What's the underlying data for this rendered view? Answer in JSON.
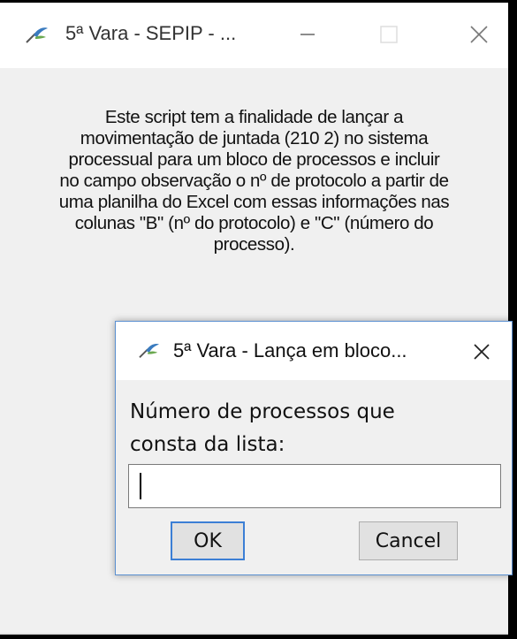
{
  "main_window": {
    "title": "5ª Vara - SEPIP - ...",
    "icon": "app-feather-icon",
    "controls": [
      "minimize-icon",
      "maximize-icon",
      "close-icon"
    ],
    "description_lines": [
      "Este script tem a finalidade de lançar a",
      "movimentação de juntada (210 2) no sistema",
      "processual para um bloco de processos e incluir",
      "no campo observação o nº de protocolo a partir de",
      "uma planilha do Excel com essas informações nas",
      "colunas \"B\" (nº do protocolo) e \"C\" (número do",
      "processo)."
    ]
  },
  "dialog": {
    "title": "5ª Vara - Lança em bloco...",
    "icon": "app-feather-icon",
    "prompt_lines": [
      "Número de processos que",
      "consta da lista:"
    ],
    "input_value": "",
    "ok_label": "OK",
    "cancel_label": "Cancel"
  },
  "colors": {
    "dialog_border": "#5a8fd0",
    "ok_focus_border": "#3c7fd5"
  }
}
